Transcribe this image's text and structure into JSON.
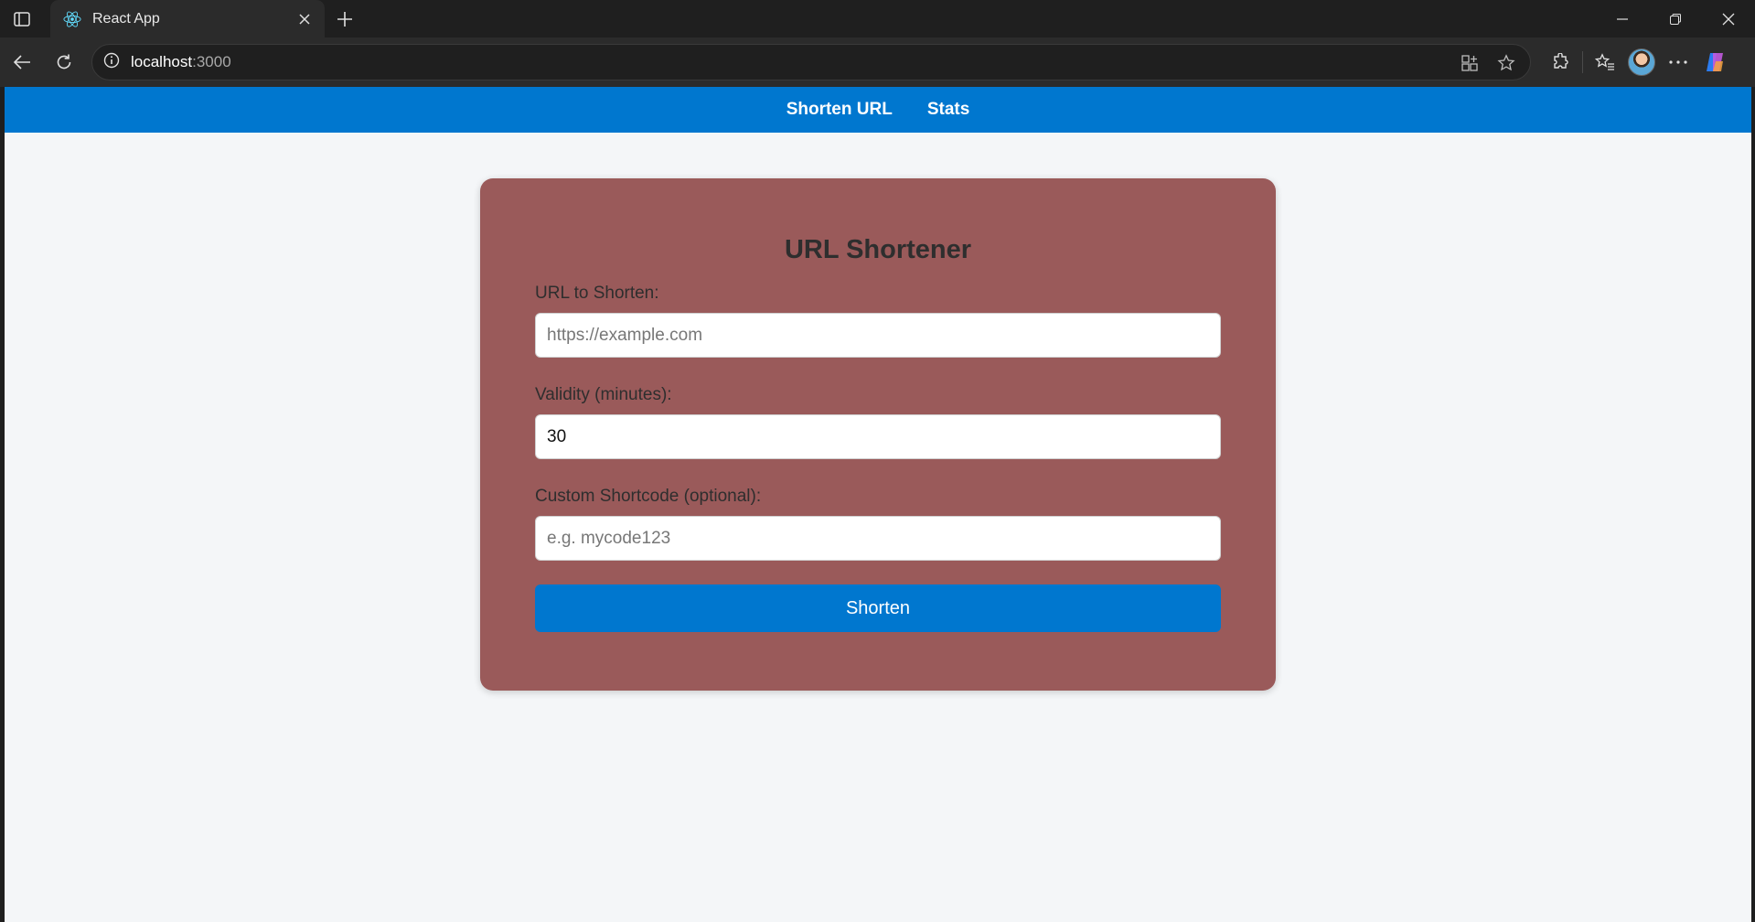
{
  "browser": {
    "tab_title": "React App",
    "url_host": "localhost",
    "url_port": ":3000"
  },
  "app_nav": {
    "items": [
      {
        "label": "Shorten URL"
      },
      {
        "label": "Stats"
      }
    ]
  },
  "form": {
    "title": "URL Shortener",
    "url_label": "URL to Shorten:",
    "url_placeholder": "https://example.com",
    "url_value": "",
    "validity_label": "Validity (minutes):",
    "validity_value": "30",
    "shortcode_label": "Custom Shortcode (optional):",
    "shortcode_placeholder": "e.g. mycode123",
    "shortcode_value": "",
    "submit_label": "Shorten"
  },
  "colors": {
    "nav_bg": "#0077cf",
    "card_bg": "#9a5a5a",
    "button_bg": "#0077cf",
    "page_bg": "#f4f6f8"
  }
}
